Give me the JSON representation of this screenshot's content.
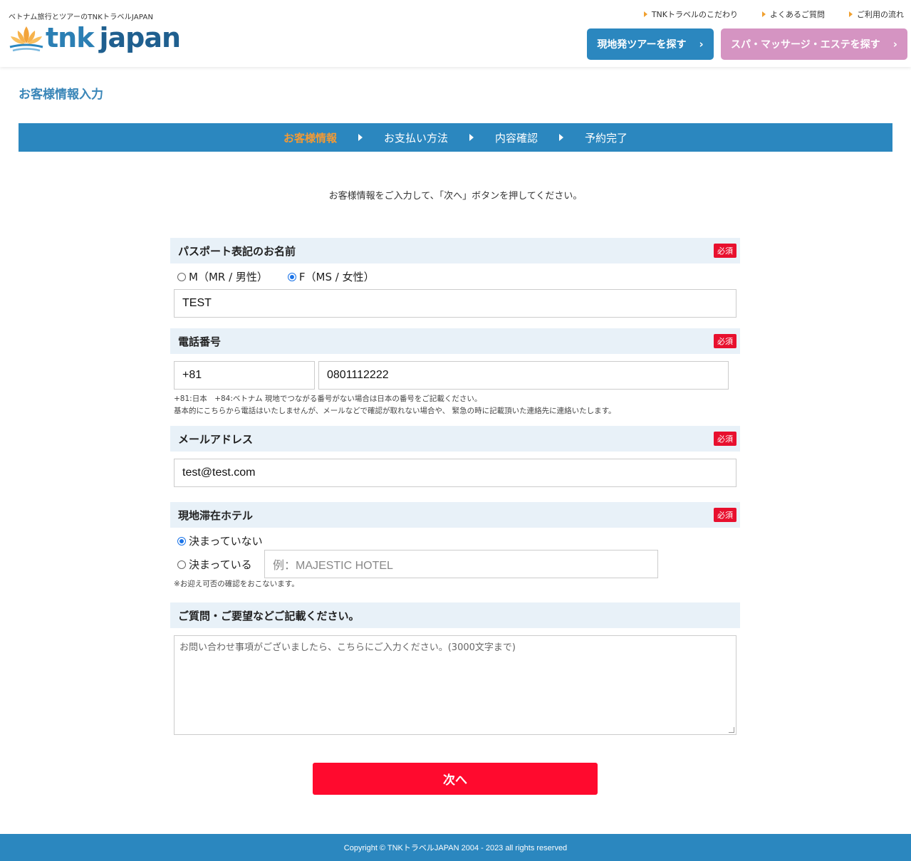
{
  "header": {
    "tagline": "ベトナム旅行とツアーのTNKトラベルJAPAN",
    "logo_tnk": "tnk",
    "logo_japan": "japan",
    "nav": [
      {
        "label": "TNKトラベルのこだわり"
      },
      {
        "label": "よくあるご質問"
      },
      {
        "label": "ご利用の流れ"
      }
    ],
    "tour_button": "現地発ツアーを探す",
    "spa_button": "スパ・マッサージ・エステを探す",
    "chevron": "›",
    "colors": {
      "brand_blue": "#2b87bf",
      "spa_pink": "#d594c2",
      "accent_orange": "#f39a34"
    }
  },
  "page": {
    "title": "お客様情報入力",
    "intro": "お客様情報をご入力して、「次へ」ボタンを押してください。"
  },
  "steps": [
    {
      "label": "お客様情報",
      "active": true
    },
    {
      "label": "お支払い方法",
      "active": false
    },
    {
      "label": "内容確認",
      "active": false
    },
    {
      "label": "予約完了",
      "active": false
    }
  ],
  "form": {
    "required_label": "必須",
    "name": {
      "label": "パスポート表記のお名前",
      "gender_m": "M（MR / 男性）",
      "gender_f": "F（MS / 女性）",
      "gender_selected": "F",
      "value": "TEST"
    },
    "phone": {
      "label": "電話番号",
      "country_code": "+81",
      "number": "0801112222",
      "note1": "+81:日本　+84:ベトナム 現地でつながる番号がない場合は日本の番号をご記載ください。",
      "note2": "基本的にこちらから電話はいたしませんが、メールなどで確認が取れない場合や、 緊急の時に記載頂いた連絡先に連絡いたします。"
    },
    "email": {
      "label": "メールアドレス",
      "value": "test@test.com"
    },
    "hotel": {
      "label": "現地滞在ホテル",
      "option_undecided": "決まっていない",
      "option_decided": "決まっている",
      "selected": "undecided",
      "placeholder": "例：MAJESTIC HOTEL",
      "note": "※お迎え可否の確認をおこないます。"
    },
    "questions": {
      "label": "ご質問・ご要望などご記載ください。",
      "placeholder": "お問い合わせ事項がございましたら、こちらにご入力ください。(3000文字まで)"
    },
    "next_button": "次へ"
  },
  "footer": {
    "copyright": "Copyright © TNKトラベルJAPAN 2004 - 2023 all rights reserved"
  }
}
